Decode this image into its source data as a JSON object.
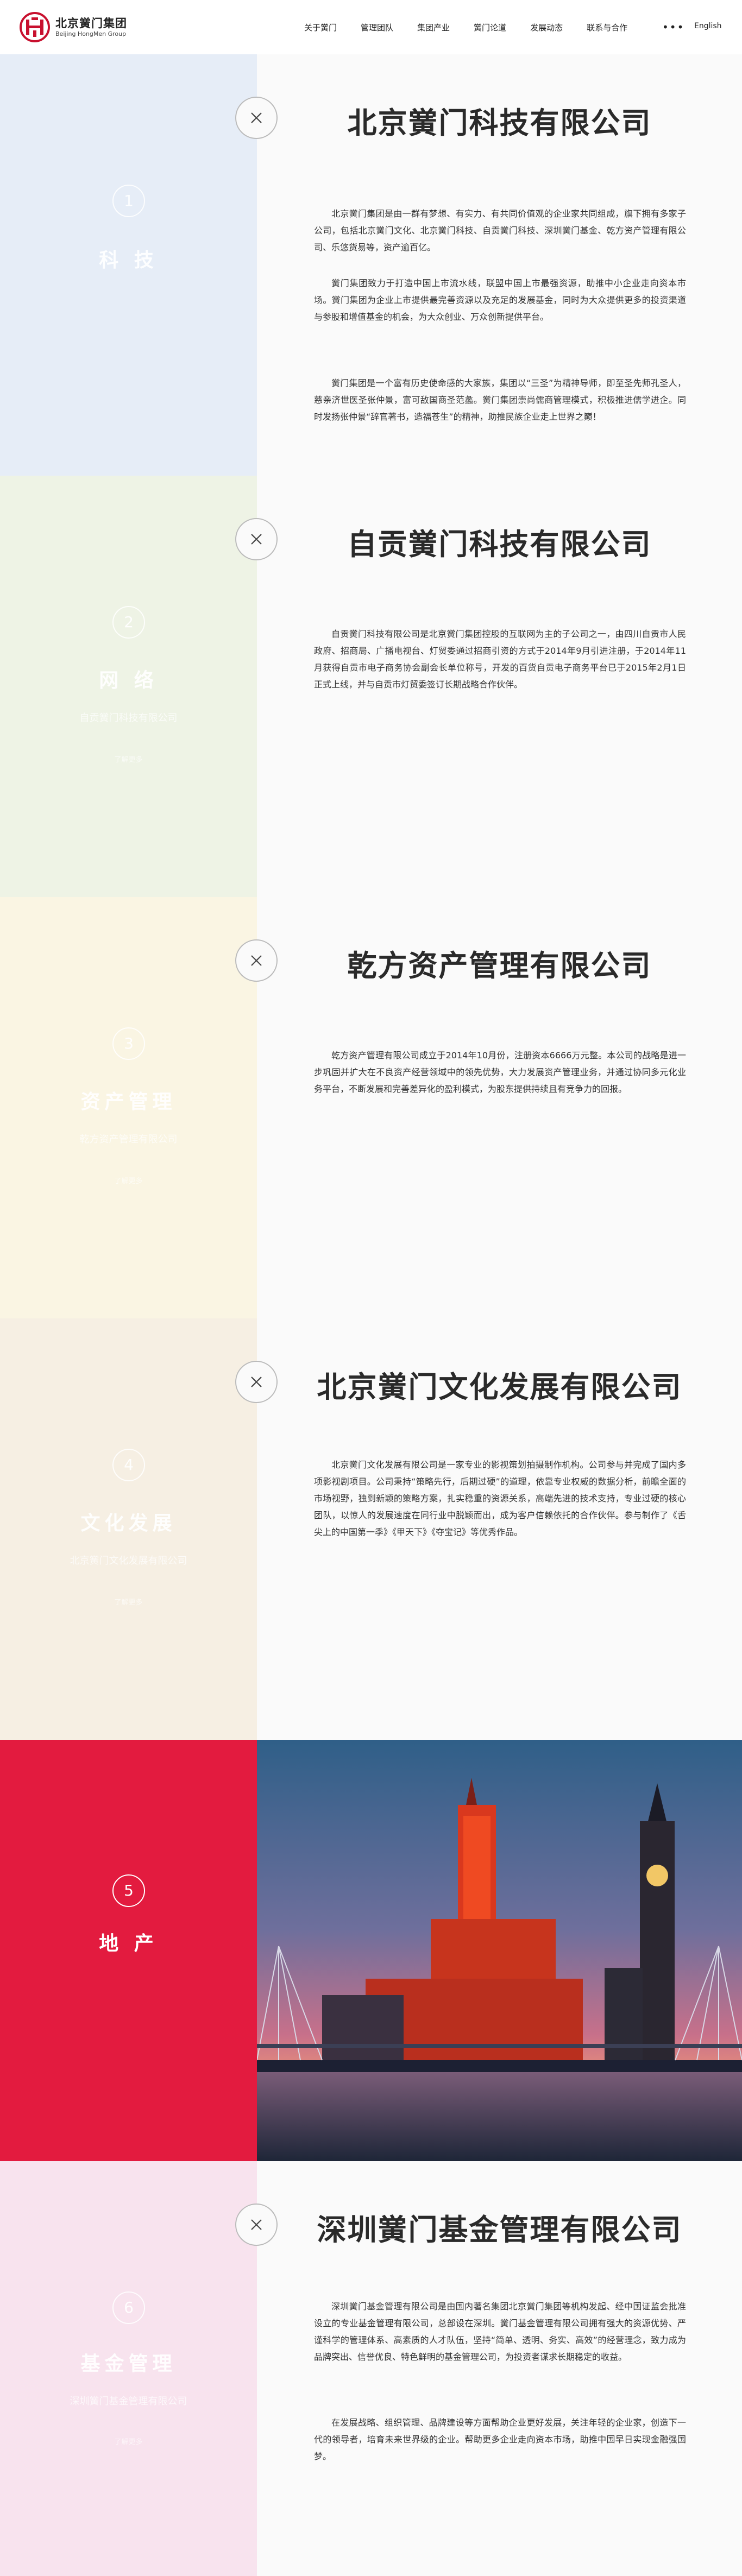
{
  "header": {
    "logo_cn": "北京黉门集团",
    "logo_en": "Beijing HongMen Group",
    "nav": [
      "关于黉门",
      "管理团队",
      "集团产业",
      "黉门论道",
      "发展动态",
      "联系与合作"
    ],
    "more": "•••",
    "lang": "English"
  },
  "colors": {
    "keji": "#e6edf7",
    "wangluo": "#eef3e5",
    "zichan": "#faf5e3",
    "wenhua": "#f6efe3",
    "dichan": "#e31b3f",
    "jijin": "#f8e3ee",
    "close_border": "#bbbbbb"
  },
  "sections": [
    {
      "num": "1",
      "name": "科 技",
      "sub": "",
      "more": "",
      "title": "北京黉门科技有限公司",
      "paragraphs": [
        "北京黉门集团是由一群有梦想、有实力、有共同价值观的企业家共同组成，旗下拥有多家子公司，包括北京黉门文化、北京黉门科技、自贡黉门科技、深圳黉门基金、乾方资产管理有限公司、乐悠货易等，资产逾百亿。",
        "黉门集团致力于打造中国上市流水线，联盟中国上市最强资源，助推中小企业走向资本市场。黉门集团为企业上市提供最完善资源以及充足的发展基金，同时为大众提供更多的投资渠道与参股和增值基金的机会，为大众创业、万众创新提供平台。",
        "黉门集团是一个富有历史使命感的大家族，集团以“三圣”为精神导师，即至圣先师孔圣人，慈亲济世医圣张仲景，富可敌国商圣范蠡。黉门集团崇尚儒商管理模式，积极推进儒学进企。同时发扬张仲景“辞官著书，造福苍生”的精神，助推民族企业走上世界之巅！"
      ]
    },
    {
      "num": "2",
      "name": "网 络",
      "sub": "自贡黉门科技有限公司",
      "more": "了解更多",
      "title": "自贡黉门科技有限公司",
      "paragraphs": [
        "自贡黉门科技有限公司是北京黉门集团控股的互联网为主的子公司之一，由四川自贡市人民政府、招商局、广播电视台、灯贸委通过招商引资的方式于2014年9月引进注册，于2014年11月获得自贡市电子商务协会副会长单位称号，开发的百货自贡电子商务平台已于2015年2月1日正式上线，并与自贡市灯贸委签订长期战略合作伙伴。"
      ]
    },
    {
      "num": "3",
      "name": "资产管理",
      "sub": "乾方资产管理有限公司",
      "more": "了解更多",
      "title": "乾方资产管理有限公司",
      "paragraphs": [
        "乾方资产管理有限公司成立于2014年10月份，注册资本6666万元整。本公司的战略是进一步巩固并扩大在不良资产经营领域中的领先优势，大力发展资产管理业务，并通过协同多元化业务平台，不断发展和完善差异化的盈利模式，为股东提供持续且有竞争力的回报。"
      ]
    },
    {
      "num": "4",
      "name": "文化发展",
      "sub": "北京黉门文化发展有限公司",
      "more": "了解更多",
      "title": "北京黉门文化发展有限公司",
      "paragraphs": [
        "北京黉门文化发展有限公司是一家专业的影视策划拍摄制作机构。公司参与并完成了国内多项影视剧项目。公司秉持“策略先行，后期过硬”的道理，依靠专业权威的数据分析，前瞻全面的市场视野，独到新颖的策略方案，扎实稳重的资源关系，高端先进的技术支持，专业过硬的核心团队，以惊人的发展速度在同行业中脱颖而出，成为客户信赖依托的合作伙伴。参与制作了《舌尖上的中国第一季》《甲天下》《夺宝记》等优秀作品。"
      ]
    },
    {
      "num": "5",
      "name": "地 产",
      "sub": "",
      "more": "",
      "title": "",
      "paragraphs": []
    },
    {
      "num": "6",
      "name": "基金管理",
      "sub": "深圳黉门基金管理有限公司",
      "more": "了解更多",
      "title": "深圳黉门基金管理有限公司",
      "paragraphs": [
        "深圳黉门基金管理有限公司是由国内著名集团北京黉门集团等机构发起、经中国证监会批准设立的专业基金管理有限公司，总部设在深圳。黉门基金管理有限公司拥有强大的资源优势、严谨科学的管理体系、高素质的人才队伍，坚持“简单、透明、务实、高效”的经营理念，致力成为品牌突出、信誉优良、特色鲜明的基金管理公司，为投资者谋求长期稳定的收益。",
        "在发展战略、组织管理、品牌建设等方面帮助企业更好发展，关注年轻的企业家，创造下一代的领导者，培育未来世界级的企业。帮助更多企业走向资本市场，助推中国早日实现金融强国梦。"
      ]
    }
  ]
}
